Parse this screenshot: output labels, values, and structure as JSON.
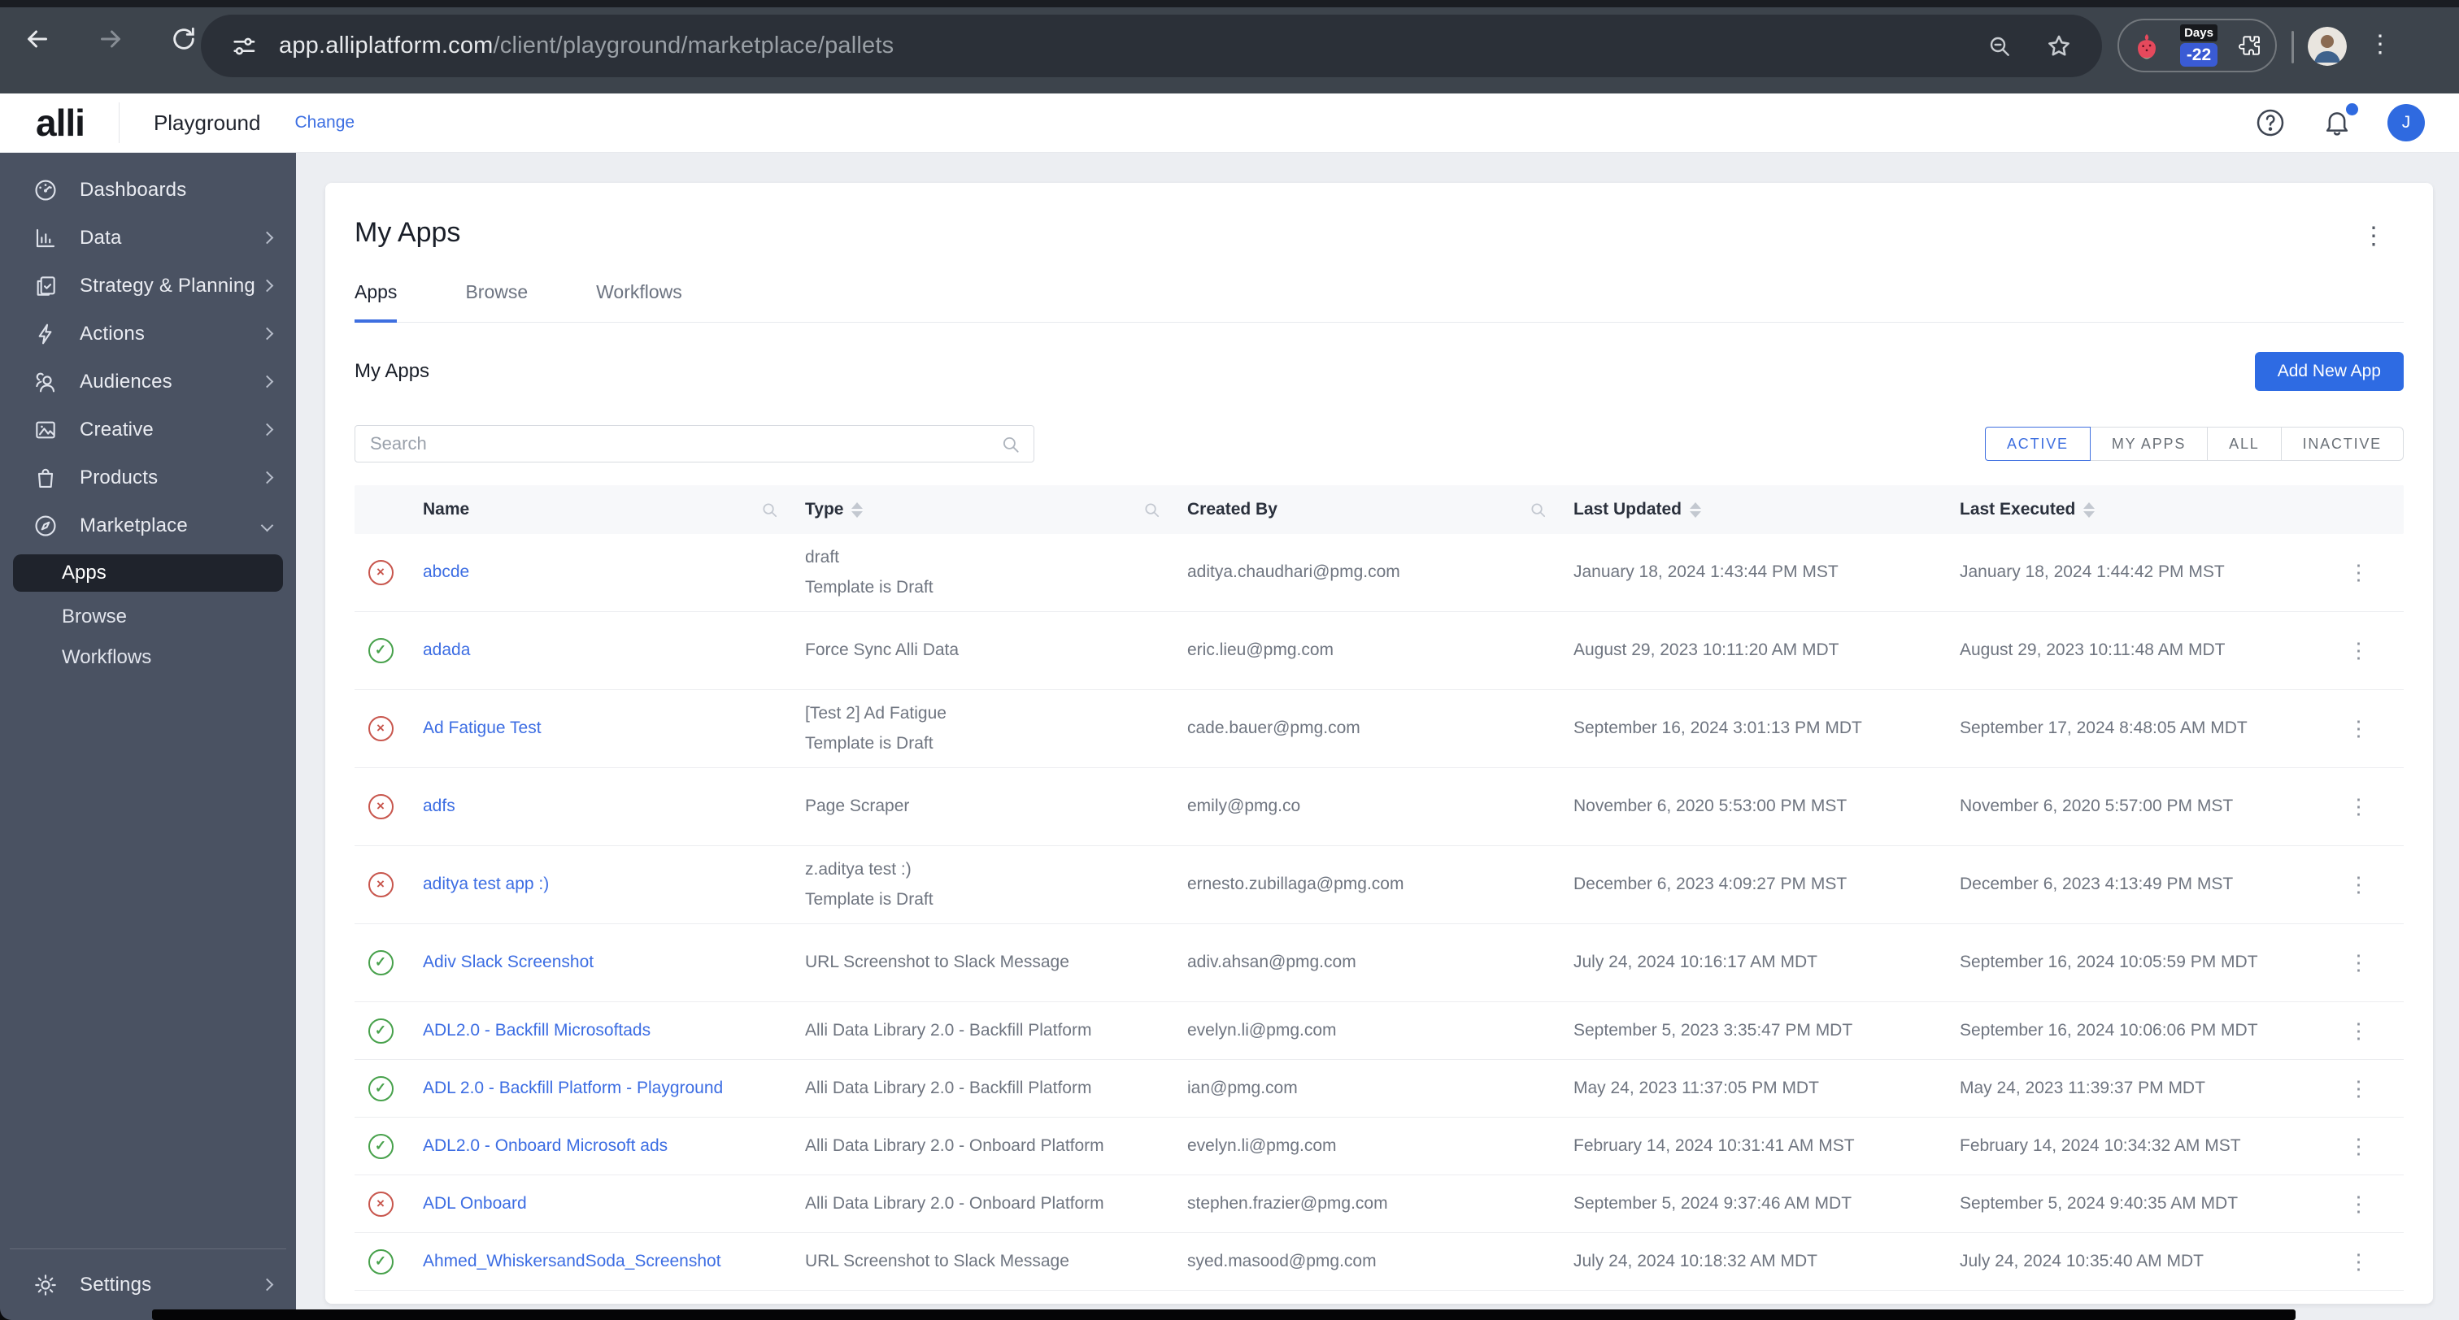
{
  "browser": {
    "url_host": "app.alliplatform.com",
    "url_path": "/client/playground/marketplace/pallets",
    "days_badge": {
      "label": "Days",
      "value": "-22"
    }
  },
  "header": {
    "logo": "alli",
    "workspace": "Playground",
    "change_label": "Change",
    "avatar_initial": "J"
  },
  "sidebar": {
    "items": [
      {
        "label": "Dashboards",
        "icon": "dashboard-icon"
      },
      {
        "label": "Data",
        "icon": "data-icon"
      },
      {
        "label": "Strategy & Planning",
        "icon": "strategy-icon"
      },
      {
        "label": "Actions",
        "icon": "actions-icon"
      },
      {
        "label": "Audiences",
        "icon": "audiences-icon"
      },
      {
        "label": "Creative",
        "icon": "creative-icon"
      },
      {
        "label": "Products",
        "icon": "products-icon"
      },
      {
        "label": "Marketplace",
        "icon": "marketplace-icon"
      }
    ],
    "subitems": [
      {
        "label": "Apps",
        "selected": true
      },
      {
        "label": "Browse",
        "selected": false
      },
      {
        "label": "Workflows",
        "selected": false
      }
    ],
    "settings_label": "Settings"
  },
  "main": {
    "page_title": "My Apps",
    "tabs": [
      {
        "label": "Apps",
        "active": true
      },
      {
        "label": "Browse",
        "active": false
      },
      {
        "label": "Workflows",
        "active": false
      }
    ],
    "section_title": "My Apps",
    "add_button_label": "Add New App",
    "search_placeholder": "Search",
    "filters": [
      {
        "label": "ACTIVE",
        "active": true
      },
      {
        "label": "MY APPS",
        "active": false
      },
      {
        "label": "ALL",
        "active": false
      },
      {
        "label": "INACTIVE",
        "active": false
      }
    ],
    "table": {
      "columns": [
        "Name",
        "Type",
        "Created By",
        "Last Updated",
        "Last Executed"
      ],
      "rows": [
        {
          "status": "error",
          "name": "abcde",
          "type": "draft",
          "type_sub": "Template is Draft",
          "created_by": "aditya.chaudhari@pmg.com",
          "last_updated": "January 18, 2024 1:43:44 PM MST",
          "last_executed": "January 18, 2024 1:44:42 PM MST"
        },
        {
          "status": "ok",
          "name": "adada",
          "type": "Force Sync Alli Data",
          "type_sub": "",
          "created_by": "eric.lieu@pmg.com",
          "last_updated": "August 29, 2023 10:11:20 AM MDT",
          "last_executed": "August 29, 2023 10:11:48 AM MDT"
        },
        {
          "status": "error",
          "name": "Ad Fatigue Test",
          "type": "[Test 2] Ad Fatigue",
          "type_sub": "Template is Draft",
          "created_by": "cade.bauer@pmg.com",
          "last_updated": "September 16, 2024 3:01:13 PM MDT",
          "last_executed": "September 17, 2024 8:48:05 AM MDT"
        },
        {
          "status": "error",
          "name": "adfs",
          "type": "Page Scraper",
          "type_sub": "",
          "created_by": "emily@pmg.co",
          "last_updated": "November 6, 2020 5:53:00 PM MST",
          "last_executed": "November 6, 2020 5:57:00 PM MST"
        },
        {
          "status": "error",
          "name": "aditya test app :)",
          "type": "z.aditya test :)",
          "type_sub": "Template is Draft",
          "created_by": "ernesto.zubillaga@pmg.com",
          "last_updated": "December 6, 2023 4:09:27 PM MST",
          "last_executed": "December 6, 2023 4:13:49 PM MST"
        },
        {
          "status": "ok",
          "name": "Adiv Slack Screenshot",
          "type": "URL Screenshot to Slack Message",
          "type_sub": "",
          "created_by": "adiv.ahsan@pmg.com",
          "last_updated": "July 24, 2024 10:16:17 AM MDT",
          "last_executed": "September 16, 2024 10:05:59 PM MDT"
        },
        {
          "status": "ok",
          "name": "ADL2.0 - Backfill Microsoftads",
          "type": "Alli Data Library 2.0 - Backfill Platform",
          "type_sub": "",
          "created_by": "evelyn.li@pmg.com",
          "last_updated": "September 5, 2023 3:35:47 PM MDT",
          "last_executed": "September 16, 2024 10:06:06 PM MDT"
        },
        {
          "status": "ok",
          "name": "ADL 2.0 - Backfill Platform - Playground",
          "type": "Alli Data Library 2.0 - Backfill Platform",
          "type_sub": "",
          "created_by": "ian@pmg.com",
          "last_updated": "May 24, 2023 11:37:05 PM MDT",
          "last_executed": "May 24, 2023 11:39:37 PM MDT"
        },
        {
          "status": "ok",
          "name": "ADL2.0 - Onboard Microsoft ads",
          "type": "Alli Data Library 2.0 - Onboard Platform",
          "type_sub": "",
          "created_by": "evelyn.li@pmg.com",
          "last_updated": "February 14, 2024 10:31:41 AM MST",
          "last_executed": "February 14, 2024 10:34:32 AM MST"
        },
        {
          "status": "error",
          "name": "ADL Onboard",
          "type": "Alli Data Library 2.0 - Onboard Platform",
          "type_sub": "",
          "created_by": "stephen.frazier@pmg.com",
          "last_updated": "September 5, 2024 9:37:46 AM MDT",
          "last_executed": "September 5, 2024 9:40:35 AM MDT"
        },
        {
          "status": "ok",
          "name": "Ahmed_WhiskersandSoda_Screenshot",
          "type": "URL Screenshot to Slack Message",
          "type_sub": "",
          "created_by": "syed.masood@pmg.com",
          "last_updated": "July 24, 2024 10:18:32 AM MDT",
          "last_executed": "July 24, 2024 10:35:40 AM MDT"
        }
      ]
    }
  },
  "icons": {
    "ok_glyph": "✓",
    "error_glyph": "×",
    "kebab_glyph": "⋮"
  },
  "colors": {
    "accent": "#2f6ae0",
    "link": "#3c6de3",
    "error": "#c8564d",
    "success": "#47a14b",
    "sidebar": "#4a5262"
  }
}
